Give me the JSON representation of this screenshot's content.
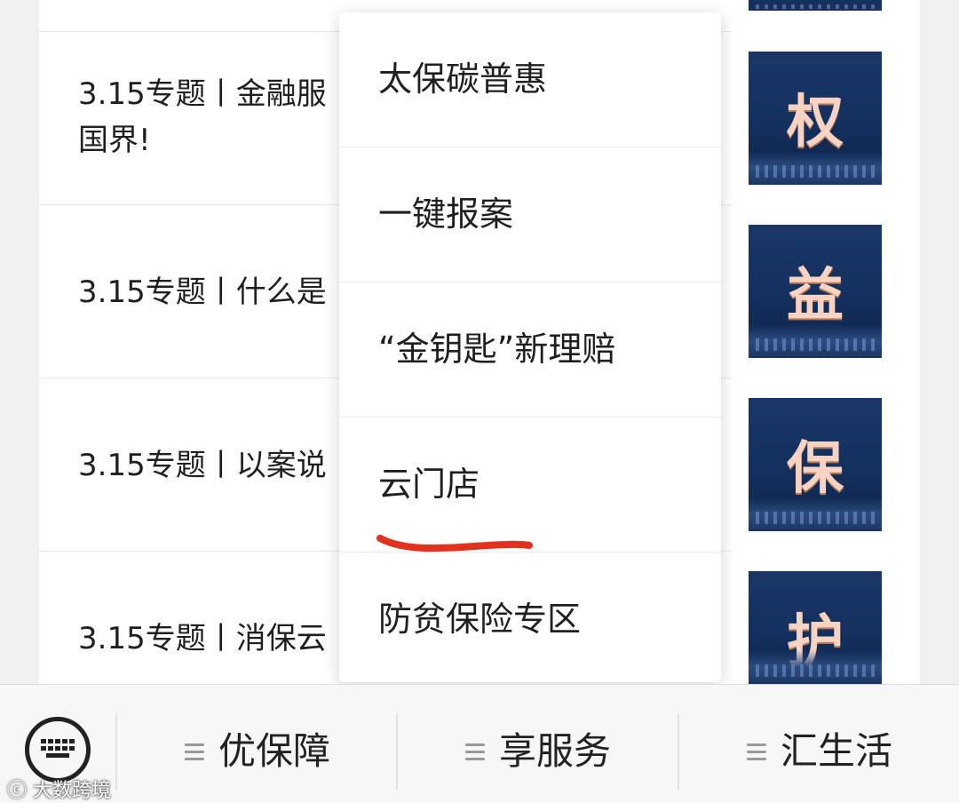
{
  "articles": [
    {
      "title_line1": "3.15专题丨金融服",
      "title_line2": "国界!"
    },
    {
      "title_line1": "3.15专题丨什么是",
      "title_line2": ""
    },
    {
      "title_line1": "3.15专题丨以案说",
      "title_line2": ""
    },
    {
      "title_line1": "3.15专题丨消保云",
      "title_line2": ""
    }
  ],
  "thumbnails": [
    "权",
    "益",
    "保",
    "护"
  ],
  "popup_menu": {
    "items": [
      {
        "label": "太保碳普惠"
      },
      {
        "label": "一键报案"
      },
      {
        "label": "“金钥匙”新理赔"
      },
      {
        "label": "云门店"
      },
      {
        "label": "防贫保险专区"
      }
    ],
    "highlight_color": "#e2321e"
  },
  "tabbar": {
    "tabs": [
      {
        "label": "优保障"
      },
      {
        "label": "享服务"
      },
      {
        "label": "汇生活"
      }
    ]
  },
  "watermark": "大数跨境"
}
